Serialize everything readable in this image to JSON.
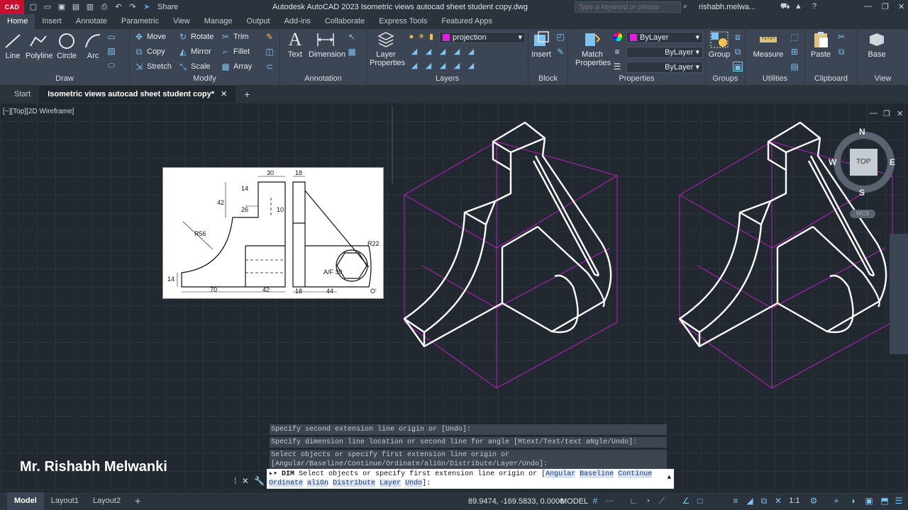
{
  "titlebar": {
    "logo": "CAD",
    "share": "Share",
    "window_title": "Autodesk AutoCAD 2023   Isometric views autocad sheet student copy.dwg",
    "search_placeholder": "Type a keyword or phrase",
    "user": "rishabh.melwa..."
  },
  "menu": {
    "tabs": [
      "Home",
      "Insert",
      "Annotate",
      "Parametric",
      "View",
      "Manage",
      "Output",
      "Add-ins",
      "Collaborate",
      "Express Tools",
      "Featured Apps"
    ],
    "active": "Home"
  },
  "ribbon": {
    "draw": {
      "title": "Draw",
      "line": "Line",
      "polyline": "Polyline",
      "circle": "Circle",
      "arc": "Arc"
    },
    "modify": {
      "title": "Modify",
      "move": "Move",
      "rotate": "Rotate",
      "trim": "Trim",
      "copy": "Copy",
      "mirror": "Mirror",
      "fillet": "Fillet",
      "stretch": "Stretch",
      "scale": "Scale",
      "array": "Array"
    },
    "annotation": {
      "title": "Annotation",
      "text": "Text",
      "dimension": "Dimension"
    },
    "layers": {
      "title": "Layers",
      "layer_properties": "Layer Properties",
      "current_layer": "projection"
    },
    "block": {
      "title": "Block",
      "insert": "Insert"
    },
    "properties": {
      "title": "Properties",
      "match": "Match Properties",
      "color": "ByLayer",
      "linetype": "ByLayer",
      "lineweight": "ByLayer"
    },
    "groups": {
      "title": "Groups",
      "group": "Group"
    },
    "utilities": {
      "title": "Utilities",
      "measure": "Measure"
    },
    "clipboard": {
      "title": "Clipboard",
      "paste": "Paste"
    },
    "view": {
      "title": "View",
      "base": "Base"
    }
  },
  "filetabs": {
    "start": "Start",
    "current": "Isometric views autocad sheet student copy*",
    "add": "+"
  },
  "viewport": {
    "label": "[−][Top][2D Wireframe]"
  },
  "navcube": {
    "n": "N",
    "s": "S",
    "e": "E",
    "w": "W",
    "face": "TOP",
    "wcs": "WCS"
  },
  "reference": {
    "dims": [
      "30",
      "18",
      "14",
      "42",
      "26",
      "10",
      "R56",
      "R22",
      "A/F 30",
      "14",
      "70",
      "42",
      "18",
      "44",
      "O'"
    ]
  },
  "command": {
    "history": [
      "Specify second extension line origin or [Undo]:",
      "Specify dimension line location or second line for angle [Mtext/Text/text aNgle/Undo]:",
      "Select objects or specify first extension line origin or [Angular/Baseline/Continue/Ordinate/aliGn/Distribute/Layer/Undo]:"
    ],
    "prompt_cmd": "DIM",
    "prompt_text": "Select objects or specify first extension line origin or [",
    "options": [
      "Angular",
      "Baseline",
      "Continue",
      "Ordinate",
      "aliGn",
      "Distribute",
      "Layer",
      "Undo"
    ],
    "prompt_end": "]:"
  },
  "author": "Mr. Rishabh Melwanki",
  "status": {
    "tabs": [
      "Model",
      "Layout1",
      "Layout2"
    ],
    "active": "Model",
    "add": "+",
    "coords": "89.9474, -169.5833, 0.0000",
    "space": "MODEL",
    "scale": "1:1"
  },
  "colors": {
    "accent": "#c8102e",
    "magenta": "#c020c0",
    "layer_swatch": "#e020e0"
  }
}
